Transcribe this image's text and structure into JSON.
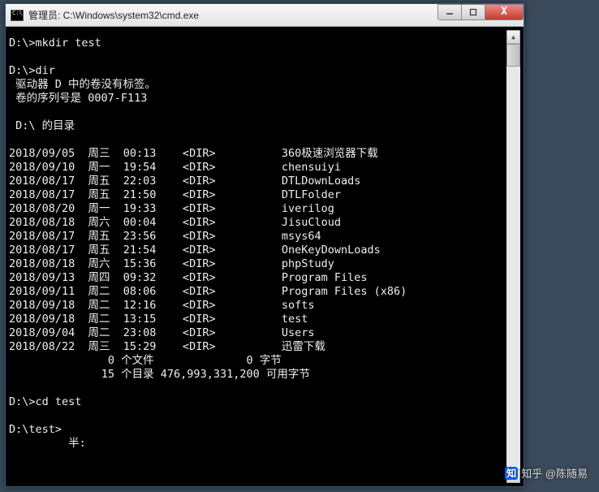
{
  "window": {
    "title": "管理员: C:\\Windows\\system32\\cmd.exe",
    "icon_text": "C:\\."
  },
  "controls": {
    "min_label": "—",
    "max_label": "▢",
    "close_label": "X"
  },
  "scrollbar": {
    "up": "▲",
    "down": "▼"
  },
  "prompts": {
    "p1": "D:\\>mkdir test",
    "p2": "D:\\>dir",
    "vol1": " 驱动器 D 中的卷没有标签。",
    "vol2": " 卷的序列号是 0007-F113",
    "header": " D:\\ 的目录",
    "p3": "D:\\>cd test",
    "p4": "D:\\test>",
    "ime": "         半:"
  },
  "listing": [
    {
      "date": "2018/09/05",
      "day": "周三",
      "time": "00:13",
      "type": "<DIR>",
      "name": "360极速浏览器下载"
    },
    {
      "date": "2018/09/10",
      "day": "周一",
      "time": "19:54",
      "type": "<DIR>",
      "name": "chensuiyi"
    },
    {
      "date": "2018/08/17",
      "day": "周五",
      "time": "22:03",
      "type": "<DIR>",
      "name": "DTLDownLoads"
    },
    {
      "date": "2018/08/17",
      "day": "周五",
      "time": "21:50",
      "type": "<DIR>",
      "name": "DTLFolder"
    },
    {
      "date": "2018/08/20",
      "day": "周一",
      "time": "19:33",
      "type": "<DIR>",
      "name": "iverilog"
    },
    {
      "date": "2018/08/18",
      "day": "周六",
      "time": "00:04",
      "type": "<DIR>",
      "name": "JisuCloud"
    },
    {
      "date": "2018/08/17",
      "day": "周五",
      "time": "23:56",
      "type": "<DIR>",
      "name": "msys64"
    },
    {
      "date": "2018/08/17",
      "day": "周五",
      "time": "21:54",
      "type": "<DIR>",
      "name": "OneKeyDownLoads"
    },
    {
      "date": "2018/08/18",
      "day": "周六",
      "time": "15:36",
      "type": "<DIR>",
      "name": "phpStudy"
    },
    {
      "date": "2018/09/13",
      "day": "周四",
      "time": "09:32",
      "type": "<DIR>",
      "name": "Program Files"
    },
    {
      "date": "2018/09/11",
      "day": "周二",
      "time": "08:06",
      "type": "<DIR>",
      "name": "Program Files (x86)"
    },
    {
      "date": "2018/09/18",
      "day": "周二",
      "time": "12:16",
      "type": "<DIR>",
      "name": "softs"
    },
    {
      "date": "2018/09/18",
      "day": "周二",
      "time": "13:15",
      "type": "<DIR>",
      "name": "test"
    },
    {
      "date": "2018/09/04",
      "day": "周二",
      "time": "23:08",
      "type": "<DIR>",
      "name": "Users"
    },
    {
      "date": "2018/08/22",
      "day": "周三",
      "time": "15:29",
      "type": "<DIR>",
      "name": "迅雷下载"
    }
  ],
  "summary": {
    "files": "               0 个文件              0 字节",
    "dirs": "              15 个目录 476,993,331,200 可用字节"
  },
  "watermark": {
    "logo": "知",
    "text": "知乎 @陈随易"
  }
}
